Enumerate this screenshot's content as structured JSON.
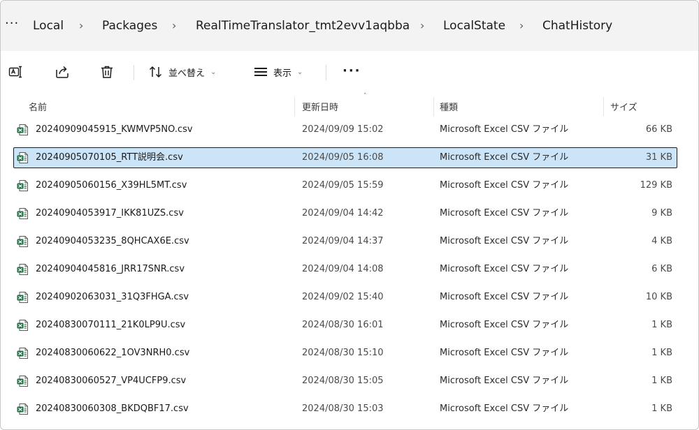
{
  "breadcrumb": {
    "more": "···",
    "separator": "›",
    "items": [
      {
        "label": "Local"
      },
      {
        "label": "Packages"
      },
      {
        "label": "RealTimeTranslator_tmt2evv1aqbba"
      },
      {
        "label": "LocalState"
      },
      {
        "label": "ChatHistory"
      }
    ]
  },
  "toolbar": {
    "rename_icon": "rename-icon",
    "share_icon": "share-icon",
    "delete_icon": "trash-icon",
    "sort_label": "並べ替え",
    "view_label": "表示",
    "more_label": "···",
    "chevron": "⌄"
  },
  "columns": {
    "name": "名前",
    "date": "更新日時",
    "type": "種類",
    "size": "サイズ",
    "sort_caret": "˄"
  },
  "files": [
    {
      "name": "20240909045915_KWMVP5NO.csv",
      "date": "2024/09/09 15:02",
      "type": "Microsoft Excel CSV ファイル",
      "size": "66 KB",
      "selected": false
    },
    {
      "name": "20240905070105_RTT説明会.csv",
      "date": "2024/09/05 16:08",
      "type": "Microsoft Excel CSV ファイル",
      "size": "31 KB",
      "selected": true
    },
    {
      "name": "20240905060156_X39HL5MT.csv",
      "date": "2024/09/05 15:59",
      "type": "Microsoft Excel CSV ファイル",
      "size": "129 KB",
      "selected": false
    },
    {
      "name": "20240904053917_IKK81UZS.csv",
      "date": "2024/09/04 14:42",
      "type": "Microsoft Excel CSV ファイル",
      "size": "9 KB",
      "selected": false
    },
    {
      "name": "20240904053235_8QHCAX6E.csv",
      "date": "2024/09/04 14:37",
      "type": "Microsoft Excel CSV ファイル",
      "size": "4 KB",
      "selected": false
    },
    {
      "name": "20240904045816_JRR17SNR.csv",
      "date": "2024/09/04 14:08",
      "type": "Microsoft Excel CSV ファイル",
      "size": "6 KB",
      "selected": false
    },
    {
      "name": "20240902063031_31Q3FHGA.csv",
      "date": "2024/09/02 15:40",
      "type": "Microsoft Excel CSV ファイル",
      "size": "10 KB",
      "selected": false
    },
    {
      "name": "20240830070111_21K0LP9U.csv",
      "date": "2024/08/30 16:01",
      "type": "Microsoft Excel CSV ファイル",
      "size": "1 KB",
      "selected": false
    },
    {
      "name": "20240830060622_1OV3NRH0.csv",
      "date": "2024/08/30 15:10",
      "type": "Microsoft Excel CSV ファイル",
      "size": "1 KB",
      "selected": false
    },
    {
      "name": "20240830060527_VP4UCFP9.csv",
      "date": "2024/08/30 15:05",
      "type": "Microsoft Excel CSV ファイル",
      "size": "1 KB",
      "selected": false
    },
    {
      "name": "20240830060308_BKDQBF17.csv",
      "date": "2024/08/30 15:03",
      "type": "Microsoft Excel CSV ファイル",
      "size": "1 KB",
      "selected": false
    }
  ],
  "colors": {
    "selected_bg": "#cce4f7",
    "excel_green": "#1d7044"
  }
}
